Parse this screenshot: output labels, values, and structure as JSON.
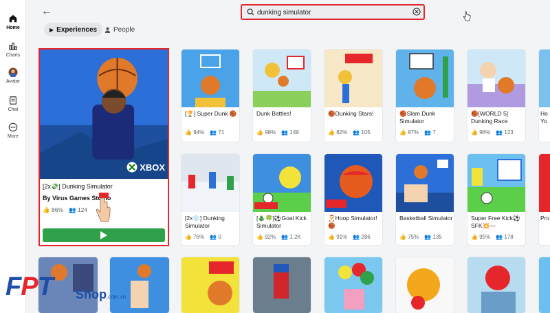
{
  "sidebar": {
    "items": [
      {
        "label": "Home",
        "icon": "home-icon"
      },
      {
        "label": "Charts",
        "icon": "charts-icon"
      },
      {
        "label": "Avatar",
        "icon": "avatar-icon"
      },
      {
        "label": "Chat",
        "icon": "chat-icon"
      },
      {
        "label": "More",
        "icon": "more-icon"
      }
    ]
  },
  "search": {
    "value": "dunking simulator"
  },
  "filters": {
    "experiences": "Experiences",
    "people": "People"
  },
  "featured": {
    "title": "[2x💸] Dunking Simulator",
    "by": "By  Virus Games Studio",
    "likes": "86%",
    "players": "124",
    "badge": "XBOX"
  },
  "games": [
    {
      "title": "[🏆] Super Dunk 🏀",
      "likes": "94%",
      "players": "71"
    },
    {
      "title": "Dunk Battles!",
      "likes": "98%",
      "players": "149"
    },
    {
      "title": "🏀Dunking Stars!",
      "likes": "82%",
      "players": "105"
    },
    {
      "title": "🏀Slam Dunk Simulator",
      "likes": "97%",
      "players": "7"
    },
    {
      "title": "🏀[WORLD 5] Dunking Race",
      "likes": "98%",
      "players": "123"
    },
    {
      "title": "Ho Yo"
    },
    {
      "title": "[2x❄️] Dunking Simulator",
      "likes": "76%",
      "players": "0"
    },
    {
      "title": "[🎄🍀]⚽Goal Kick Simulator",
      "likes": "92%",
      "players": "1.2K"
    },
    {
      "title": "🎅Hoop Simulator!🏀",
      "likes": "91%",
      "players": "286"
    },
    {
      "title": "Basketball Simulator",
      "likes": "75%",
      "players": "135"
    },
    {
      "title": "Super Free Kick⚽SFK💥—",
      "likes": "95%",
      "players": "178"
    },
    {
      "title": "Pro"
    }
  ],
  "watermark": {
    "brand_f": "F",
    "brand_p": "P",
    "brand_t": "T",
    "shop": "Shop",
    "domain": ".com.vn"
  },
  "colors": {
    "highlight": "#e5262b",
    "play": "#2fa14a",
    "brand": "#1e4ea8"
  }
}
